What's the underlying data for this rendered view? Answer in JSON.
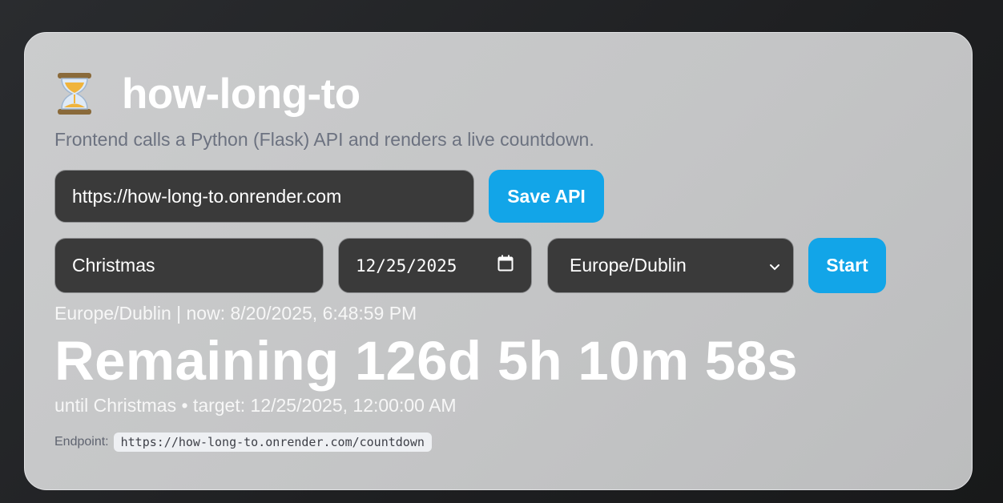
{
  "app": {
    "icon": "hourglass-icon",
    "title": "how-long-to",
    "subtitle": "Frontend calls a Python (Flask) API and renders a live countdown."
  },
  "api": {
    "url_value": "https://how-long-to.onrender.com",
    "save_label": "Save API"
  },
  "event": {
    "name_value": "Christmas",
    "date_value": "12/25/2025",
    "timezone_value": "Europe/Dublin",
    "start_label": "Start"
  },
  "status": {
    "now_line": "Europe/Dublin | now: 8/20/2025, 6:48:59 PM",
    "remaining": "Remaining 126d 5h 10m 58s",
    "until_line": "until Christmas • target: 12/25/2025, 12:00:00 AM"
  },
  "endpoint": {
    "label": "Endpoint:",
    "url": "https://how-long-to.onrender.com/countdown"
  },
  "colors": {
    "accent": "#12a5e8",
    "input_bg": "#3a3a3a",
    "card_bg": "#c6c7c8"
  }
}
